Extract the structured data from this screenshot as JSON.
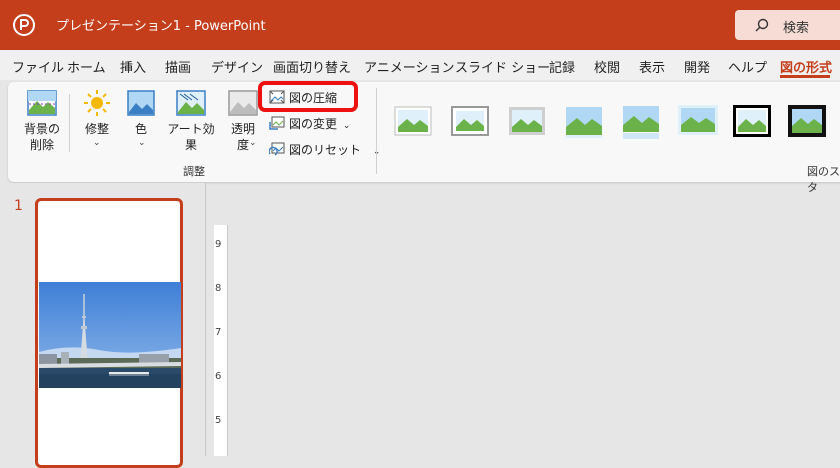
{
  "titlebar": {
    "title": "プレゼンテーション1  -  PowerPoint",
    "search_label": "検索",
    "accent": "#c43e1c"
  },
  "tabs": [
    {
      "label": "ファイル"
    },
    {
      "label": "ホーム"
    },
    {
      "label": "挿入"
    },
    {
      "label": "描画"
    },
    {
      "label": "デザイン"
    },
    {
      "label": "画面切り替え"
    },
    {
      "label": "アニメーション"
    },
    {
      "label": "スライド ショー"
    },
    {
      "label": "記録"
    },
    {
      "label": "校閲"
    },
    {
      "label": "表示"
    },
    {
      "label": "開発"
    },
    {
      "label": "ヘルプ"
    },
    {
      "label": "図の形式",
      "active": true
    }
  ],
  "ribbon": {
    "remove_bg": [
      "背景の",
      "削除"
    ],
    "corrections": "修整",
    "color": "色",
    "artistic": "アート効果",
    "transparency": [
      "透明",
      "度"
    ],
    "compress": "図の圧縮",
    "change": "図の変更",
    "reset": "図のリセット",
    "group_adjust": "調整",
    "group_styles": "図のスタ"
  },
  "slides": {
    "number": "1"
  },
  "ruler": {
    "marks": [
      "9",
      "8",
      "7",
      "6",
      "5"
    ]
  },
  "highlight_color": "#ee1111"
}
